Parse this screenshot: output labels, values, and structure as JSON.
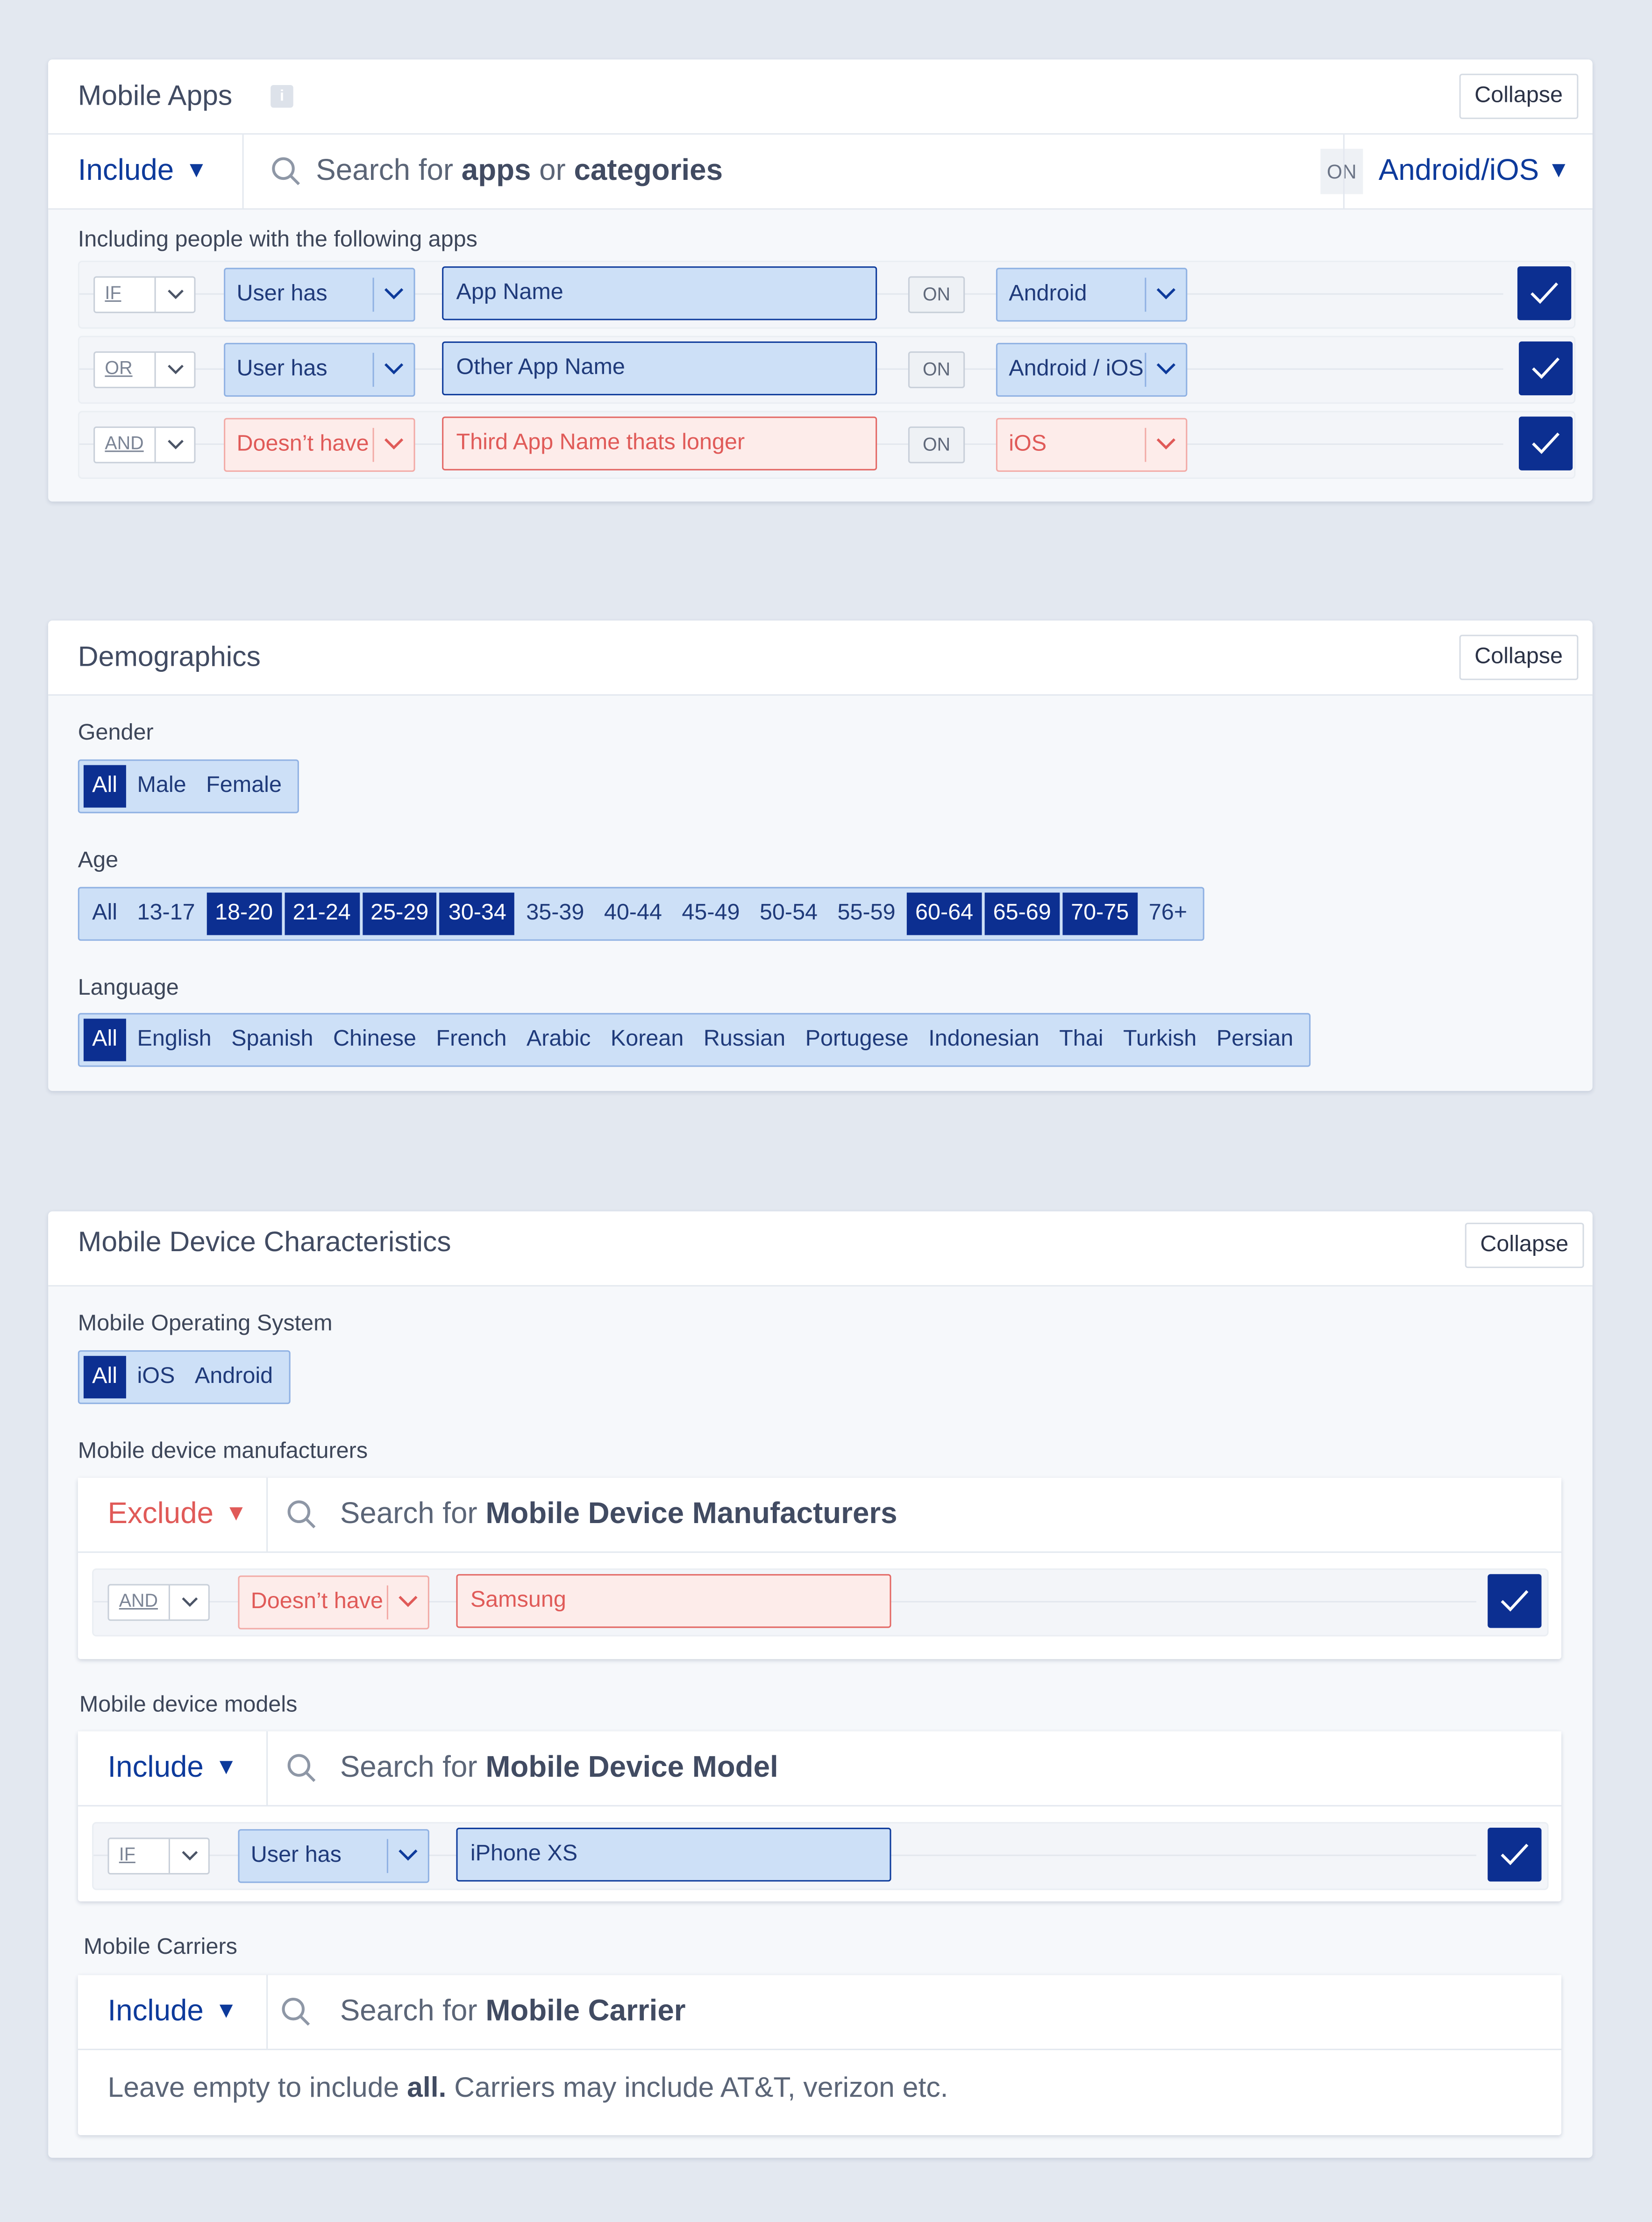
{
  "mobile_apps": {
    "title": "Mobile Apps",
    "info_icon": "i",
    "collapse_label": "Collapse",
    "include_label": "Include",
    "search_prefix": "Search for ",
    "search_bold1": "apps",
    "search_mid": " or ",
    "search_bold2": "categories",
    "on_label": "ON",
    "platform_label": "Android/iOS",
    "rules_heading": "Including people with the following apps",
    "rules": [
      {
        "connector": "IF",
        "condition": "User has",
        "app": "App Name",
        "on": "ON",
        "platform": "Android",
        "style": "blue"
      },
      {
        "connector": "OR",
        "condition": "User has",
        "app": "Other App Name",
        "on": "ON",
        "platform": "Android / iOS",
        "style": "blue"
      },
      {
        "connector": "AND",
        "condition": "Doesn’t have",
        "app": "Third App Name thats longer",
        "on": "ON",
        "platform": "iOS",
        "style": "red"
      }
    ]
  },
  "demographics": {
    "title": "Demographics",
    "collapse_label": "Collapse",
    "gender_label": "Gender",
    "gender_options": [
      "All",
      "Male",
      "Female"
    ],
    "age_label": "Age",
    "age_options": [
      "All",
      "13-17",
      "18-20",
      "21-24",
      "25-29",
      "30-34",
      "35-39",
      "40-44",
      "45-49",
      "50-54",
      "55-59",
      "60-64",
      "65-69",
      "70-75",
      "76+"
    ],
    "language_label": "Language",
    "language_options": [
      "All",
      "English",
      "Spanish",
      "Chinese",
      "French",
      "Arabic",
      "Korean",
      "Russian",
      "Portugese",
      "Indonesian",
      "Thai",
      "Turkish",
      "Persian"
    ]
  },
  "device": {
    "title": "Mobile Device Characteristics",
    "collapse_label": "Collapse",
    "os_label": "Mobile Operating System",
    "os_options": [
      "All",
      "iOS",
      "Android"
    ],
    "manufacturers_label": "Mobile device manufacturers",
    "manufacturers": {
      "mode": "Exclude",
      "search_prefix": "Search for ",
      "search_bold": "Mobile Device Manufacturers",
      "rule": {
        "connector": "AND",
        "condition": "Doesn’t have",
        "value": "Samsung"
      }
    },
    "models_label": "Mobile device models",
    "models": {
      "mode": "Include",
      "search_prefix": "Search for ",
      "search_bold": "Mobile Device Model",
      "rule": {
        "connector": "IF",
        "condition": "User has",
        "value": "iPhone XS"
      }
    },
    "carriers_label": "Mobile Carriers",
    "carriers": {
      "mode": "Include",
      "search_prefix": "Search for ",
      "search_bold": "Mobile Carrier",
      "note_prefix": "Leave empty to include ",
      "note_bold": "all.",
      "note_suffix": " Carriers may include AT&T, verizon etc."
    }
  }
}
